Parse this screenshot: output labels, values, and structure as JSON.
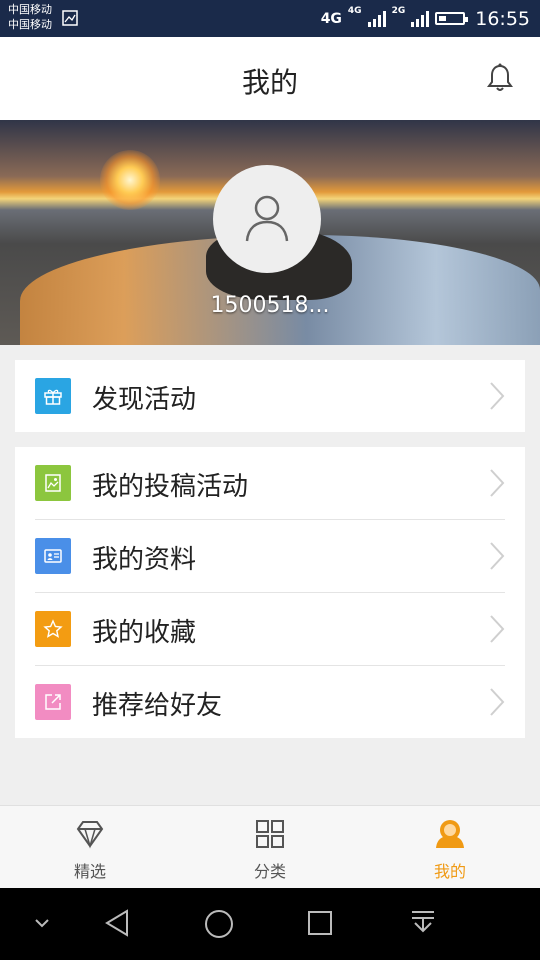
{
  "status_bar": {
    "carrier_1": "中国移动",
    "carrier_2": "中国移动",
    "network_1": "4G",
    "network_2": "4G",
    "network_3": "2G",
    "time": "16:55",
    "battery_level": 0.3
  },
  "header": {
    "title": "我的",
    "bell_icon": "bell-icon"
  },
  "profile": {
    "username": "1500518...",
    "avatar_icon": "user-icon"
  },
  "menu_section_1": [
    {
      "label": "发现活动",
      "icon": "gift-icon",
      "icon_color": "#2aa5e3"
    }
  ],
  "menu_section_2": [
    {
      "label": "我的投稿活动",
      "icon": "image-icon",
      "icon_color": "#8cc63e"
    },
    {
      "label": "我的资料",
      "icon": "id-card-icon",
      "icon_color": "#4a8fe8"
    },
    {
      "label": "我的收藏",
      "icon": "star-icon",
      "icon_color": "#f39c12"
    },
    {
      "label": "推荐给好友",
      "icon": "share-icon",
      "icon_color": "#f28cc2"
    }
  ],
  "tabs": [
    {
      "label": "精选",
      "icon": "diamond-icon",
      "active": false
    },
    {
      "label": "分类",
      "icon": "grid-icon",
      "active": false
    },
    {
      "label": "我的",
      "icon": "person-icon",
      "active": true
    }
  ],
  "colors": {
    "accent": "#f09a14",
    "status_bar": "#1a2a4a"
  }
}
